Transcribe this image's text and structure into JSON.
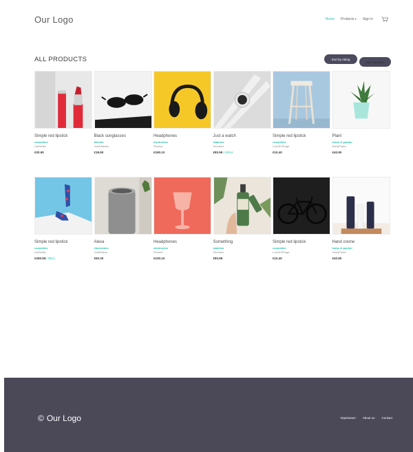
{
  "header": {
    "logo": "Our Logo",
    "nav": {
      "home": "Home",
      "products": "Products",
      "signin": "Sign in"
    }
  },
  "section": {
    "title": "ALL PRODUCTS",
    "sort_rating": "Sort by rating",
    "sort_price": "Sort by price"
  },
  "products_row1": [
    {
      "name": "Simple red lipstick",
      "category": "cosmetics",
      "brand": "LilySelise",
      "price": "€20.90",
      "discount": ""
    },
    {
      "name": "Black sunglasses",
      "category": "fashion",
      "brand": "JustGlasses",
      "price": "€18.90",
      "discount": ""
    },
    {
      "name": "Headphones",
      "category": "electronics",
      "brand": "Pioneer",
      "price": "€190.10",
      "discount": ""
    },
    {
      "name": "Just a watch",
      "category": "watches",
      "brand": "Screamz",
      "price": "€83.99",
      "discount": "(-20%)"
    },
    {
      "name": "Simple red lipstick",
      "category": "cosmetics",
      "brand": "LoveDOP.ags",
      "price": "€10.40",
      "discount": ""
    },
    {
      "name": "Plant",
      "category": "home & garden",
      "brand": "HarryPotter",
      "price": "€40.90",
      "discount": ""
    }
  ],
  "products_row2": [
    {
      "name": "Simple red lipstick",
      "category": "cosmetics",
      "brand": "LilySelise",
      "price": "€260.50",
      "discount": "(-35%)"
    },
    {
      "name": "Alexa",
      "category": "electronics",
      "brand": "JustEdison",
      "price": "€50.30",
      "discount": ""
    },
    {
      "name": "Headphones",
      "category": "electronics",
      "brand": "Pioneer",
      "price": "€230.10",
      "discount": ""
    },
    {
      "name": "Something",
      "category": "watches",
      "brand": "Screamz",
      "price": "€83.99",
      "discount": ""
    },
    {
      "name": "Simple red lipstick",
      "category": "cosmetics",
      "brand": "LoveDOP.ags",
      "price": "€10.40",
      "discount": ""
    },
    {
      "name": "Hand creme",
      "category": "home & garden",
      "brand": "HarryPotter",
      "price": "€40.90",
      "discount": ""
    }
  ],
  "footer": {
    "copyright_symbol": "©",
    "logo": "Our Logo",
    "links": {
      "impressum": "Impressum",
      "about": "About us",
      "contact": "Contact"
    }
  },
  "colors": {
    "accent": "#26c6b0",
    "button_bg": "#4b4a5e",
    "footer_bg": "#4b4858"
  },
  "icons": {
    "cart": "cart-icon",
    "products_caret": "caret-down-icon"
  }
}
